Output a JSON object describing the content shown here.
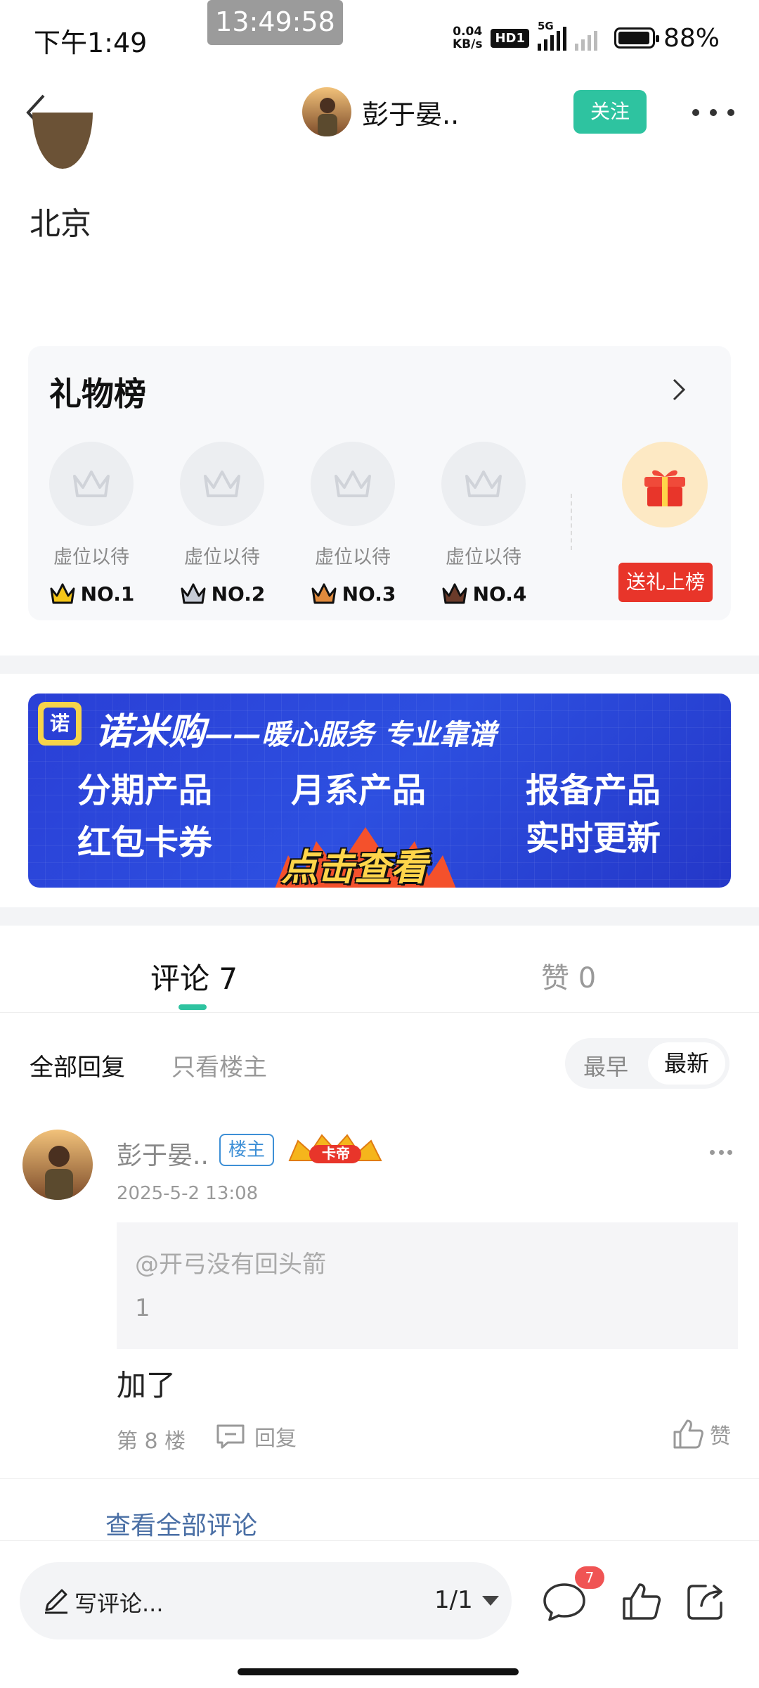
{
  "status_bar": {
    "time": "下午1:49",
    "clock_overlay": "13:49:58",
    "net_speed_value": "0.04",
    "net_speed_unit": "KB/s",
    "hd_label": "HD1",
    "network_type": "5G",
    "battery": "88%",
    "icons": [
      "signal-icon",
      "no-signal-icon",
      "battery-icon"
    ]
  },
  "nav": {
    "user_name": "彭于晏..",
    "follow_label": "关注",
    "icons": [
      "back-icon",
      "more-icon"
    ]
  },
  "post": {
    "location": "北京"
  },
  "gift_board": {
    "title": "礼物榜",
    "slots": [
      {
        "label": "虚位以待",
        "rank": "NO.1",
        "crown_color": "#f5c518"
      },
      {
        "label": "虚位以待",
        "rank": "NO.2",
        "crown_color": "#c7ccd6"
      },
      {
        "label": "虚位以待",
        "rank": "NO.3",
        "crown_color": "#e08a3c"
      },
      {
        "label": "虚位以待",
        "rank": "NO.4",
        "crown_color": "#6b3b2a"
      }
    ],
    "send_label": "送礼上榜"
  },
  "banner": {
    "logo_char": "诺",
    "brand": "诺米购",
    "tagline": "——暖心服务 专业靠谱",
    "items": [
      "分期产品",
      "月系产品",
      "报备产品",
      "红包卡券",
      "实时更新"
    ],
    "cta": "点击查看"
  },
  "tabs": {
    "comments": "评论 7",
    "likes": "赞 0"
  },
  "filters": {
    "all": "全部回复",
    "op_only": "只看楼主",
    "sort_earliest": "最早",
    "sort_latest": "最新"
  },
  "comment": {
    "user": "彭于晏..",
    "host_badge": "楼主",
    "level_badge": "卡帝",
    "time": "2025-5-2 13:08",
    "quote_user": "@开弓没有回头箭",
    "quote_text": "1",
    "body": "加了",
    "floor": "第 8 楼",
    "reply_label": "回复",
    "like_label": "赞"
  },
  "view_all": "查看全部评论",
  "bottom_bar": {
    "compose_placeholder": "写评论...",
    "page": "1/1",
    "comment_count": "7"
  },
  "colors": {
    "accent": "#2ec3a0",
    "red": "#e8352a",
    "banner_blue": "#2a3fd6"
  }
}
